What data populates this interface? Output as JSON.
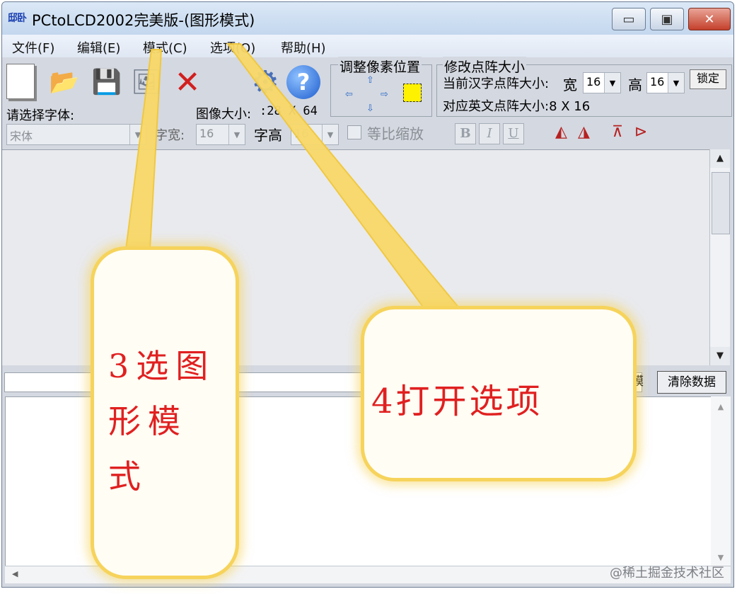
{
  "window": {
    "app_icon_text": "邸卧",
    "title": "PCtoLCD2002完美版-(图形模式)",
    "min_glyph": "▭",
    "max_glyph": "▣",
    "close_glyph": "✕"
  },
  "menu": {
    "items": [
      "文件(F)",
      "编辑(E)",
      "模式(C)",
      "选项(O)",
      "帮助(H)"
    ]
  },
  "toolbar": {
    "icons": [
      "new-file-icon",
      "open-folder-icon",
      "save-icon",
      "import-icon",
      "delete-icon",
      "settings-gear-icon",
      "help-icon"
    ],
    "help_glyph": "?",
    "delete_glyph": "✕",
    "gear_glyph": "⚙",
    "pos_group_title": "调整像素位置",
    "size_group_title": "修改点阵大小",
    "current_cn_label": "当前汉字点阵大小:",
    "width_label": "宽",
    "width_value": "16",
    "height_label": "高",
    "height_value": "16",
    "lock_label": "锁定",
    "en_size_label": "对应英文点阵大小:8 X 16",
    "font_select_label": "请选择字体:",
    "font_value": "宋体",
    "image_size_label": "图像大小:",
    "image_size_value": ":28 X 64",
    "char_width_label": "字宽:",
    "char_width_value": "16",
    "char_height_label": "字高",
    "char_height_value": "16",
    "scale_label": "等比缩放",
    "bold_label": "B",
    "italic_label": "I",
    "underline_label": "U"
  },
  "lower": {
    "clear_button": "清除数据",
    "mode_button_fragment": "模"
  },
  "annotations": {
    "step3": "3选图形模式",
    "step4": "4打开选项"
  },
  "watermark": "@稀土掘金技术社区",
  "colors": {
    "callout_border": "#f6d35b",
    "callout_text": "#e02020"
  }
}
